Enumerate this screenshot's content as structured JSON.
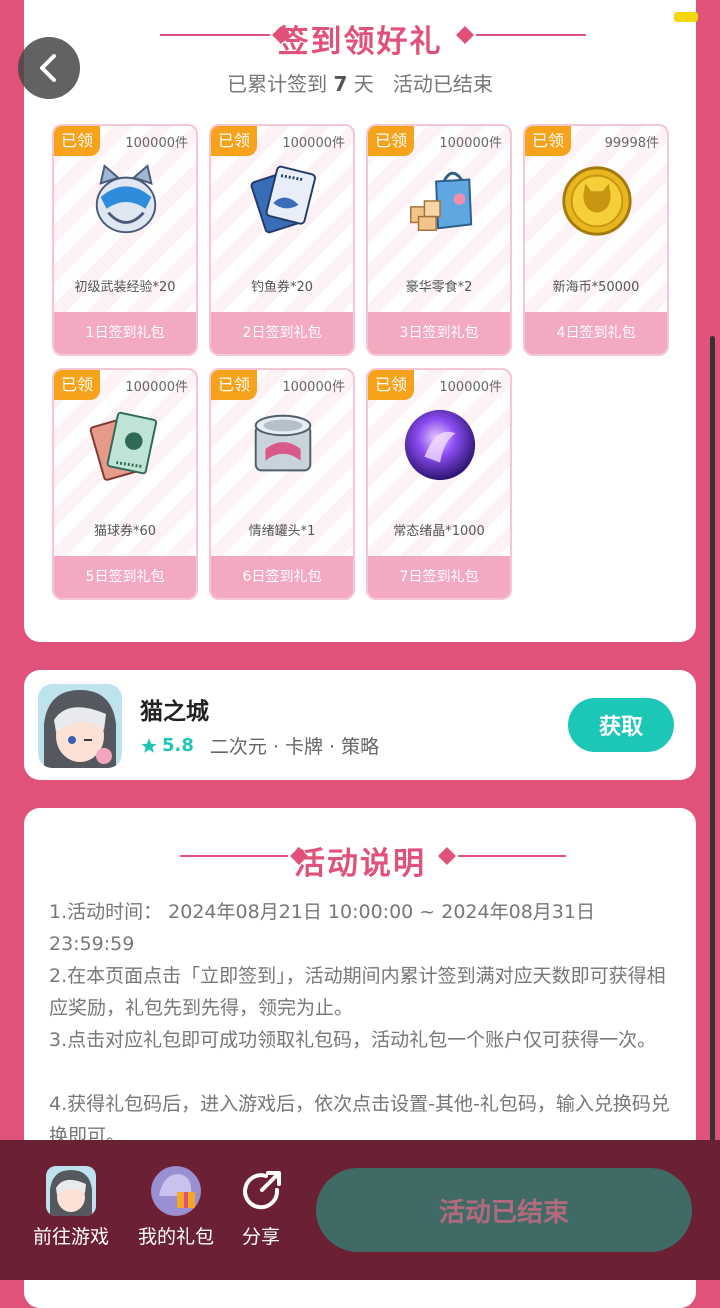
{
  "header": {
    "title": "签到领好礼",
    "subtitle_prefix": "已累计签到",
    "days": "7",
    "subtitle_unit": "天",
    "status": "活动已结束"
  },
  "gifts": [
    {
      "claimed": "已领",
      "stock": "100000件",
      "name": "初级武装经验*20",
      "day": "1日签到礼包",
      "icon": "cat-helmet-icon"
    },
    {
      "claimed": "已领",
      "stock": "100000件",
      "name": "钓鱼券*20",
      "day": "2日签到礼包",
      "icon": "fishing-ticket-icon"
    },
    {
      "claimed": "已领",
      "stock": "100000件",
      "name": "豪华零食*2",
      "day": "3日签到礼包",
      "icon": "snack-bag-icon"
    },
    {
      "claimed": "已领",
      "stock": "99998件",
      "name": "新海币*50000",
      "day": "4日签到礼包",
      "icon": "gold-coin-icon"
    },
    {
      "claimed": "已领",
      "stock": "100000件",
      "name": "猫球券*60",
      "day": "5日签到礼包",
      "icon": "catball-ticket-icon"
    },
    {
      "claimed": "已领",
      "stock": "100000件",
      "name": "情绪罐头*1",
      "day": "6日签到礼包",
      "icon": "can-icon"
    },
    {
      "claimed": "已领",
      "stock": "100000件",
      "name": "常态绪晶*1000",
      "day": "7日签到礼包",
      "icon": "crystal-orb-icon"
    }
  ],
  "app": {
    "name": "猫之城",
    "rating": "5.8",
    "tags": "二次元 · 卡牌 · 策略",
    "get_label": "获取"
  },
  "rules": {
    "title": "活动说明",
    "items": [
      "1.活动时间： 2024年08月21日 10:00:00 ~ 2024年08月31日 23:59:59",
      "2.在本页面点击「立即签到」，活动期间内累计签到满对应天数即可获得相应奖励，礼包先到先得，领完为止。",
      "3.点击对应礼包即可成功领取礼包码，活动礼包一个账户仅可获得一次。",
      "4.获得礼包码后，进入游戏后，依次点击设置-其他-礼包码，输入兑换码兑换即可。"
    ]
  },
  "bottom_nav": {
    "go_game": "前往游戏",
    "my_gifts": "我的礼包",
    "share": "分享",
    "ended": "活动已结束"
  },
  "colors": {
    "page_bg": "#e0527a",
    "accent": "#e0527a",
    "claimed_badge": "#f7a21b",
    "day_bar": "#f3a9bf",
    "get_button": "#1dc7b8",
    "ended_button": "#3f6a66"
  }
}
